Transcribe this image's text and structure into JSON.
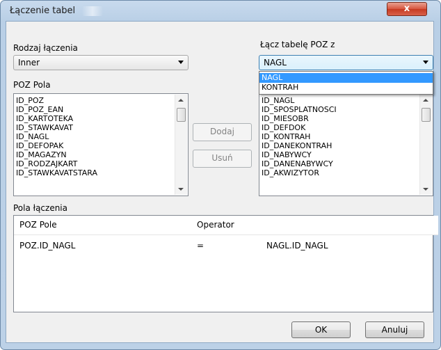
{
  "window": {
    "title": "Łączenie tabel",
    "close_label": "x"
  },
  "join_type": {
    "label": "Rodzaj łączenia",
    "value": "Inner"
  },
  "join_table": {
    "label": "Łącz tabelę POZ z",
    "value": "NAGL",
    "options": [
      "NAGL",
      "KONTRAH"
    ],
    "selected_index": 0
  },
  "left_fields": {
    "label": "POZ Pola",
    "items": [
      "ID_POZ",
      "ID_POZ_EAN",
      "ID_KARTOTEKA",
      "ID_STAWKAVAT",
      "ID_NAGL",
      "ID_DEFOPAK",
      "ID_MAGAZYN",
      "ID_RODZAJKART",
      "ID_STAWKAVATSTARA"
    ]
  },
  "right_fields": {
    "items": [
      "ID_NAGL",
      "ID_SPOSPLATNOSCI",
      "ID_MIESOBR",
      "ID_DEFDOK",
      "ID_KONTRAH",
      "ID_DANEKONTRAH",
      "ID_NABYWCY",
      "ID_DANENABYWCY",
      "ID_AKWIZYTOR"
    ]
  },
  "actions": {
    "add_label": "Dodaj",
    "remove_label": "Usuń"
  },
  "joins": {
    "label": "Pola łączenia",
    "columns": [
      "POZ Pole",
      "Operator",
      ""
    ],
    "rows": [
      [
        "POZ.ID_NAGL",
        "=",
        "NAGL.ID_NAGL"
      ]
    ]
  },
  "footer": {
    "ok_label": "OK",
    "cancel_label": "Anuluj"
  }
}
